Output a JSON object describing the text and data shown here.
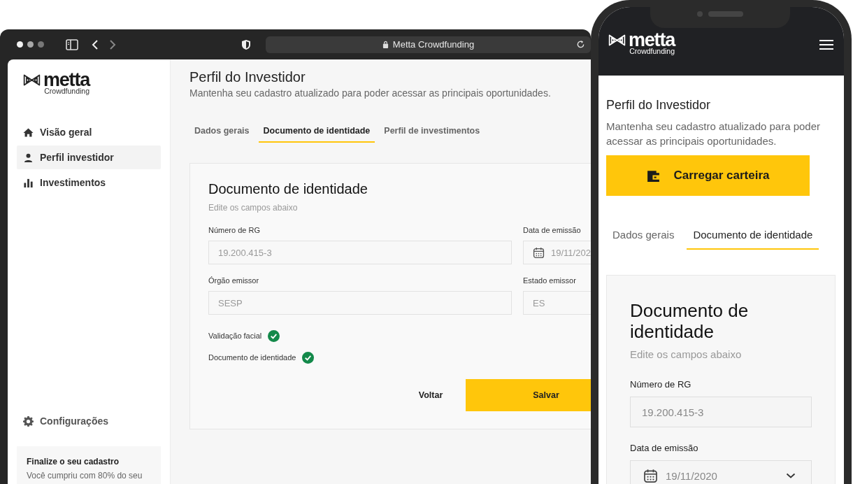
{
  "browser": {
    "address": "Metta Crowdfunding",
    "sidebar": {
      "logo": {
        "name": "metta",
        "tagline": "Crowdfunding"
      },
      "items": [
        {
          "label": "Visão geral",
          "selected": false
        },
        {
          "label": "Perfil investidor",
          "selected": true
        },
        {
          "label": "Investimentos",
          "selected": false
        }
      ],
      "settings": "Configurações",
      "notice": {
        "title": "Finalize o seu cadastro",
        "text": "Você cumpriu com 80% do seu"
      }
    },
    "page": {
      "title": "Perfil do Investidor",
      "subtitle": "Mantenha seu cadastro atualizado para poder acessar as principais oportunidades.",
      "tabs": [
        {
          "label": "Dados gerais",
          "selected": false
        },
        {
          "label": "Documento de identidade",
          "selected": true
        },
        {
          "label": "Perfil de investimentos",
          "selected": false
        }
      ],
      "card": {
        "title": "Documento de identidade",
        "subtitle": "Edite os campos abaixo",
        "fields": [
          {
            "label": "Número de RG",
            "value": "19.200.415-3",
            "kind": "text"
          },
          {
            "label": "Data de emissão",
            "value": "19/11/202",
            "kind": "date"
          },
          {
            "label": "Órgão emissor",
            "value": "SESP",
            "kind": "text"
          },
          {
            "label": "Estado emissor",
            "value": "ES",
            "kind": "text"
          }
        ],
        "validations": [
          {
            "label": "Validação facial",
            "checked": true
          },
          {
            "label": "Documento de identidade",
            "checked": true
          }
        ],
        "buttons": [
          {
            "label": "Voltar",
            "kind": "secondary"
          },
          {
            "label": "Salvar",
            "kind": "primary"
          }
        ]
      }
    }
  },
  "phone": {
    "logo": {
      "name": "metta",
      "tagline": "Crowdfunding"
    },
    "title": "Perfil do Investidor",
    "subtitle": "Mantenha seu cadastro atualizado para poder acessar as principais oportunidades.",
    "action": "Carregar carteira",
    "tabs": [
      {
        "label": "Dados gerais",
        "selected": false
      },
      {
        "label": "Documento de identidade",
        "selected": true
      }
    ],
    "card": {
      "title": "Documento de identidade",
      "subtitle": "Edite os campos abaixo",
      "fields": [
        {
          "label": "Número de RG",
          "value": "19.200.415-3",
          "kind": "text"
        },
        {
          "label": "Data de emissão",
          "value": "19/11/2020",
          "kind": "date"
        }
      ]
    }
  }
}
